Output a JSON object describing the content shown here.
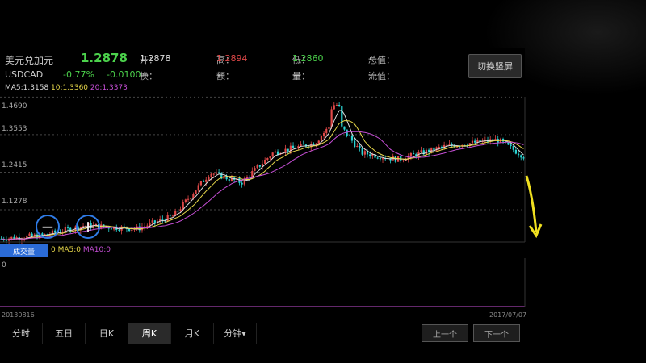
{
  "header": {
    "name": "美元兑加元",
    "price": "1.2878",
    "symbol": "USDCAD",
    "change_pct": "-0.77%",
    "change_val": "-0.0100",
    "fields": [
      {
        "label": "开：",
        "value": "1.2878",
        "color": "#ddd"
      },
      {
        "label": "高：",
        "value": "1.2894",
        "color": "#e04848"
      },
      {
        "label": "低：",
        "value": "1.2860",
        "color": "#4cd24c"
      },
      {
        "label": "总值：",
        "value": "—",
        "color": "#ddd"
      },
      {
        "label": "换：",
        "value": "—",
        "color": "#ddd"
      },
      {
        "label": "额：",
        "value": "—",
        "color": "#ddd"
      },
      {
        "label": "量：",
        "value": "—",
        "color": "#ddd"
      },
      {
        "label": "流值：",
        "value": "—",
        "color": "#ddd"
      }
    ],
    "switch_label": "切换竖屏"
  },
  "ma": {
    "ma5": "MA5:1.3158",
    "ma10": "10:1.3360",
    "ma20": "20:1.3373"
  },
  "vol": {
    "tag": "成交量",
    "ma": "0 MA5:0",
    "ma10": "MA10:0",
    "zero": "0"
  },
  "dates": {
    "start": "20130816",
    "end": "2017/07/07"
  },
  "tabs": [
    "分时",
    "五日",
    "日K",
    "周K",
    "月K",
    "分钟▾"
  ],
  "active_tab": 3,
  "page_prev": "上一个",
  "page_next": "下一个",
  "colors": {
    "up": "#e04848",
    "down": "#2bd4d4",
    "ma5": "#dddddd",
    "ma10": "#e8d84a",
    "ma20": "#c64fd6"
  },
  "chart_data": {
    "type": "candlestick",
    "y_ticks": [
      "1.4690",
      "1.3553",
      "1.2415",
      "1.1278"
    ],
    "ylim": [
      1.03,
      1.47
    ],
    "trend": [
      [
        0,
        1.04
      ],
      [
        0.08,
        1.05
      ],
      [
        0.16,
        1.08
      ],
      [
        0.26,
        1.07
      ],
      [
        0.33,
        1.11
      ],
      [
        0.4,
        1.24
      ],
      [
        0.46,
        1.21
      ],
      [
        0.52,
        1.3
      ],
      [
        0.6,
        1.33
      ],
      [
        0.64,
        1.4
      ],
      [
        0.69,
        1.3
      ],
      [
        0.76,
        1.28
      ],
      [
        0.85,
        1.32
      ],
      [
        0.95,
        1.34
      ],
      [
        1.0,
        1.29
      ]
    ]
  }
}
